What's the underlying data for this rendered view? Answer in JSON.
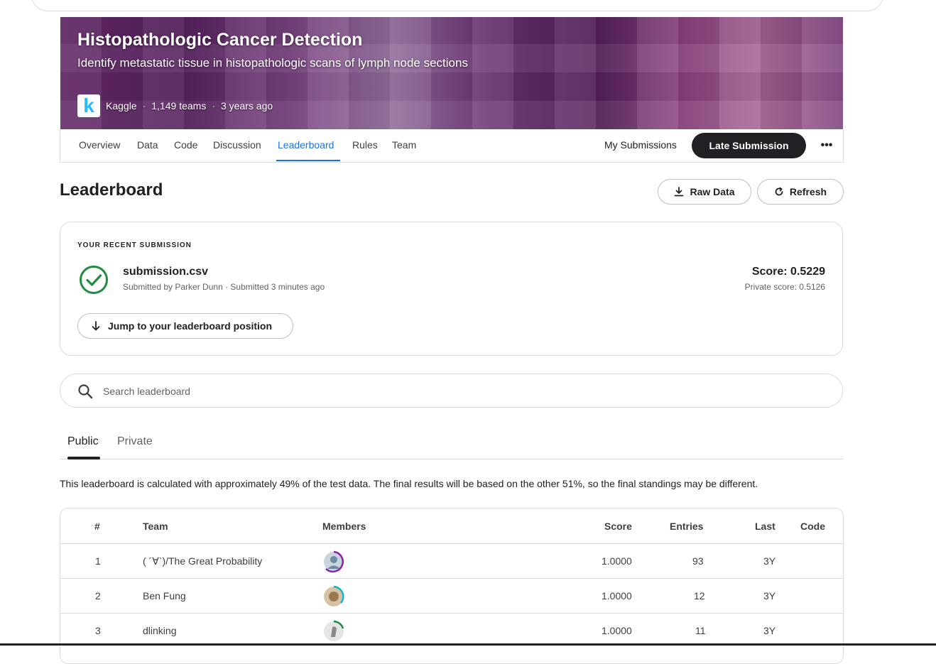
{
  "competition": {
    "title": "Histopathologic Cancer Detection",
    "subtitle": "Identify metastatic tissue in histopathologic scans of lymph node sections",
    "host": "Kaggle",
    "teams": "1,149 teams",
    "age": "3 years ago",
    "sep": "·"
  },
  "nav": {
    "tabs": [
      "Overview",
      "Data",
      "Code",
      "Discussion",
      "Leaderboard",
      "Rules",
      "Team"
    ],
    "active_tab": "Leaderboard",
    "my_submissions": "My Submissions",
    "late_submission": "Late Submission",
    "more": "•••"
  },
  "leaderboard": {
    "title": "Leaderboard",
    "raw_data": "Raw Data",
    "refresh": "Refresh"
  },
  "recent_submission": {
    "label": "YOUR RECENT SUBMISSION",
    "file": "submission.csv",
    "meta": "Submitted by Parker Dunn · Submitted 3 minutes ago",
    "score": "Score: 0.5229",
    "private_score": "Private score: 0.5126",
    "jump": "Jump to your leaderboard position"
  },
  "search": {
    "placeholder": "Search leaderboard"
  },
  "subtabs": {
    "public": "Public",
    "private": "Private",
    "active": "Public"
  },
  "note": "This leaderboard is calculated with approximately 49% of the test data. The final results will be based on the other 51%, so the final standings may be different.",
  "table": {
    "headers": {
      "rank": "#",
      "team": "Team",
      "members": "Members",
      "score": "Score",
      "entries": "Entries",
      "last": "Last",
      "code": "Code"
    },
    "rows": [
      {
        "rank": "1",
        "team": "( ´∀`)/The Great Probability",
        "score": "1.0000",
        "entries": "93",
        "last": "3Y"
      },
      {
        "rank": "2",
        "team": "Ben Fung",
        "score": "1.0000",
        "entries": "12",
        "last": "3Y"
      },
      {
        "rank": "3",
        "team": "dlinking",
        "score": "1.0000",
        "entries": "11",
        "last": "3Y"
      }
    ]
  },
  "colors": {
    "accent": "#1a73e8",
    "success": "#1e8e3e",
    "dark": "#202124",
    "kaggle_blue": "#20beff"
  }
}
